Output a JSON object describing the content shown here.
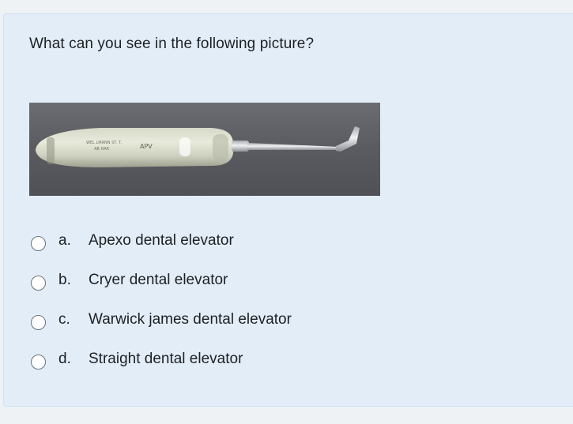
{
  "question": {
    "text": "What can you see in the following picture?",
    "image_alt": "Dental elevator instrument with white handle"
  },
  "options": [
    {
      "letter": "a.",
      "text": "Apexo dental elevator"
    },
    {
      "letter": "b.",
      "text": "Cryer dental elevator"
    },
    {
      "letter": "c.",
      "text": "Warwick james dental elevator"
    },
    {
      "letter": "d.",
      "text": "Straight dental elevator"
    }
  ],
  "colors": {
    "card_background": "#e3edf7",
    "page_background": "#eef2f5",
    "photo_background": "#5d5e63"
  }
}
